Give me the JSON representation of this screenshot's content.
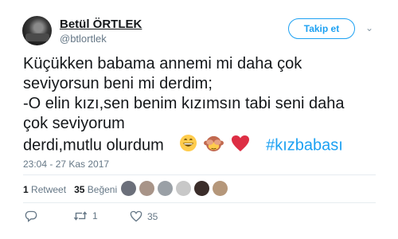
{
  "tweet": {
    "author_name": "Betül ÖRTLEK",
    "author_handle": "@btlortlek",
    "follow_label": "Takip et",
    "text_lines": [
      "Küçükken babama annemi mi daha çok",
      "seviyorsun beni mi derdim;",
      "-O elin kızı,sen benim kızımsın tabi seni daha",
      "çok seviyorum",
      "derdi,mutlu olurdum"
    ],
    "hashtag": "#kızbabası",
    "emojis": [
      "grinning-face-emoji",
      "see-no-evil-monkey-emoji",
      "red-heart-emoji"
    ],
    "timestamp": "23:04 - 27 Kas 2017",
    "retweet_count": "1",
    "retweet_label": "Retweet",
    "like_count": "35",
    "like_label": "Beğeni",
    "reply_action_count": "",
    "retweet_action_count": "1",
    "like_action_count": "35"
  },
  "likers": [
    {
      "name": "liker-avatar-1",
      "color": "#6b6f7a"
    },
    {
      "name": "liker-avatar-2",
      "color": "#a89488"
    },
    {
      "name": "liker-avatar-3",
      "color": "#9aa0a6"
    },
    {
      "name": "liker-avatar-4",
      "color": "#c8c8c8"
    },
    {
      "name": "liker-avatar-5",
      "color": "#3b2d2a"
    },
    {
      "name": "liker-avatar-6",
      "color": "#b5977a"
    }
  ],
  "colors": {
    "accent": "#1da1f2",
    "heart": "#e0245e",
    "muted": "#657786"
  }
}
